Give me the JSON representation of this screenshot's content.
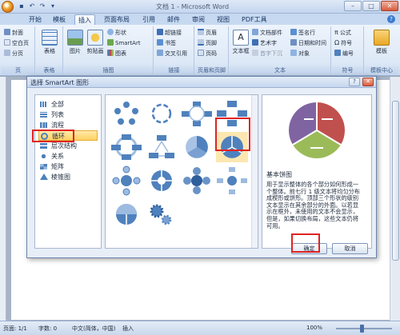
{
  "window": {
    "title": "文档 1 - Microsoft Word",
    "qat_icons": [
      "save-icon",
      "undo-icon",
      "redo-icon",
      "customize-icon"
    ]
  },
  "tabs": [
    "开始",
    "模板",
    "插入",
    "页面布局",
    "引用",
    "邮件",
    "审阅",
    "视图",
    "PDF工具"
  ],
  "active_tab": "插入",
  "ribbon": {
    "pages": {
      "label": "页",
      "items": [
        "封面",
        "空白页",
        "分页"
      ]
    },
    "table": {
      "label": "表格",
      "button": "表格"
    },
    "illustrations": {
      "label": "插图",
      "big": [
        "图片",
        "剪贴画"
      ],
      "small": [
        "形状",
        "SmartArt",
        "图表"
      ]
    },
    "links": {
      "label": "链接",
      "items": [
        "超链接",
        "书签",
        "交叉引用"
      ]
    },
    "header_footer": {
      "label": "页眉和页脚",
      "items": [
        "页眉",
        "页脚",
        "页码"
      ]
    },
    "text": {
      "label": "文本",
      "big": "文本框",
      "col1": [
        "文档部件",
        "艺术字",
        "首字下沉"
      ],
      "col2": [
        "签名行",
        "日期和时间",
        "对象"
      ]
    },
    "symbols": {
      "label": "符号",
      "items": [
        "公式",
        "符号",
        "编号"
      ]
    },
    "templates": {
      "label": "模板中心",
      "button": "模板"
    }
  },
  "dialog": {
    "title": "选择 SmartArt 图形",
    "categories": [
      "全部",
      "列表",
      "流程",
      "循环",
      "层次结构",
      "关系",
      "矩阵",
      "棱锥图"
    ],
    "selected_category": "循环",
    "preview_title": "基本饼图",
    "preview_desc": "用于显示整体的各个部分如何形成一个整体。前七行 1 级文本将均匀分布成楔形或饼形。顶部三个形状的级别文本显示在其余部分的外面。以若显示在框外，未使用的文本不会显示，但是，如果切换布局，这些文本仍将可用。",
    "ok": "确定",
    "cancel": "取消"
  },
  "status": {
    "page": "页面: 1/1",
    "words": "字数: 0",
    "language": "中文(简体，中国)",
    "mode": "插入",
    "zoom": "100%"
  },
  "colors": {
    "pie_red": "#c0504d",
    "pie_green": "#9bbb59",
    "pie_purple": "#8064a2",
    "accent_blue": "#4f81bd",
    "highlight_red": "#e02323"
  }
}
